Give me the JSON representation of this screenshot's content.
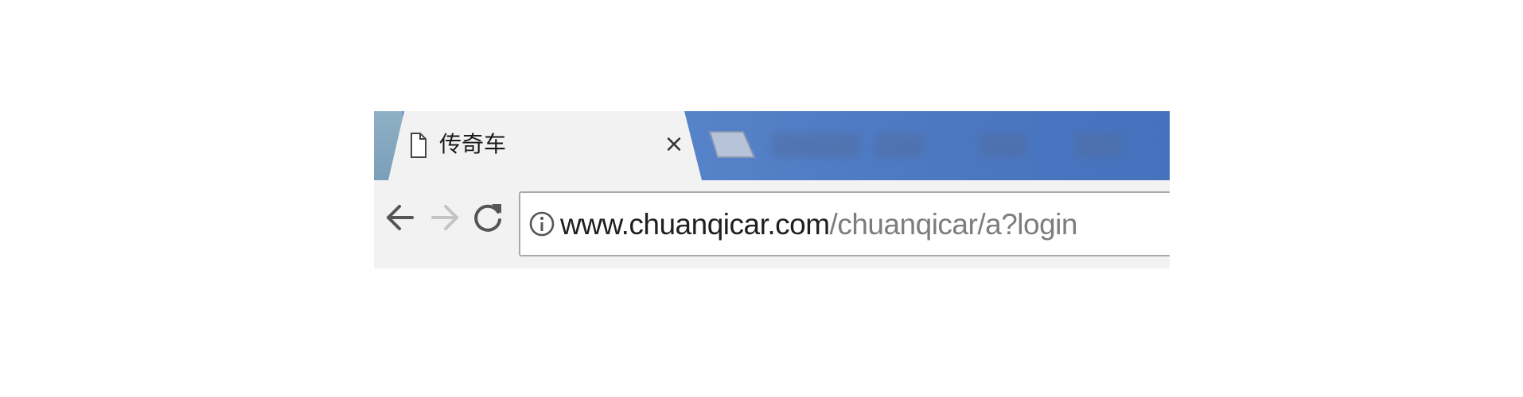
{
  "tab": {
    "title": "传奇车",
    "close_label": "×"
  },
  "address_bar": {
    "url_host": "www.chuanqicar.com",
    "url_path": "/chuanqicar/a?login"
  },
  "icons": {
    "tab_icon": "page-icon",
    "back": "arrow-left-icon",
    "forward": "arrow-right-icon",
    "reload": "reload-icon",
    "site_info": "info-icon"
  },
  "colors": {
    "tab_strip": "#4f7bc4",
    "active_tab": "#f2f2f2",
    "toolbar": "#f2f2f2",
    "url_host": "#1f1f1f",
    "url_path": "#7d7d7d"
  }
}
